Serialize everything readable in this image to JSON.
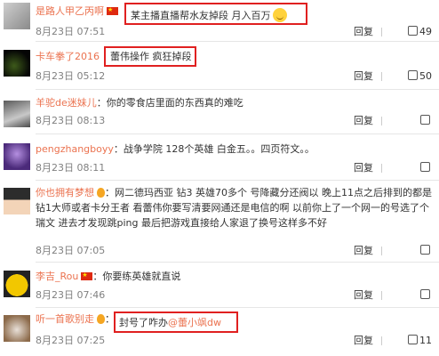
{
  "comments": [
    {
      "username": "是路人甲乙丙啊",
      "has_flag": true,
      "text": "某主播直播帮水友掉段 月入百万",
      "has_emoji": true,
      "date": "8月23日 07:51",
      "reply": "回复",
      "likes": "49",
      "highlighted": true,
      "avatar_colors": [
        "#cfcfcf",
        "#8a8a8a"
      ]
    },
    {
      "username": "卡车拳了2016",
      "has_flag": false,
      "text": "蕾伟操作 疯狂掉段",
      "date": "8月23日 05:12",
      "reply": "回复",
      "likes": "50",
      "highlighted": true,
      "avatar_colors": [
        "#0a0a0a",
        "#2b3a1a"
      ]
    },
    {
      "username": "羊驼de迷妹儿",
      "separator": "：",
      "text": "你的零食店里面的东西真的难吃",
      "date": "8月23日 08:13",
      "reply": "回复",
      "likes": "",
      "avatar_colors": [
        "#6e6e6e",
        "#c0c0c0"
      ]
    },
    {
      "username": "pengzhangboyy",
      "separator": "：",
      "text": "战争学院 128个英雄 白金五。。四页符文。。",
      "date": "8月23日 08:11",
      "reply": "回复",
      "likes": "",
      "avatar_colors": [
        "#4b2a7a",
        "#b48fe0"
      ]
    },
    {
      "username": "你也拥有梦想",
      "has_vip": true,
      "separator": "：",
      "text": "网二德玛西亚 钻3 英雄70多个 号降藏分还阀以 晚上11点之后排到的都是钻1大师或者卡分王者 看蕾伟你要写清要网通还是电信的啊 以前你上了一个网一的号选了个瑞文 进去才发现跳ping 最后把游戏直接给人家退了换号这样多不好",
      "date": "8月23日 07:05",
      "reply": "回复",
      "likes": "",
      "avatar_colors": [
        "#2c2c2c",
        "#f3d4b8"
      ]
    },
    {
      "username": "李吉_Rou",
      "has_flag": true,
      "separator": "：",
      "text": "你要练英雄就直说",
      "date": "8月23日 07:46",
      "reply": "回复",
      "likes": "",
      "avatar_colors": [
        "#f2c700",
        "#222222"
      ]
    },
    {
      "username": "听一首歌别走",
      "has_vip": true,
      "separator": "：",
      "text": "封号了咋办",
      "mention": "@蕾小飒dw",
      "date": "8月23日 07:25",
      "reply": "回复",
      "likes": "11",
      "highlighted": true,
      "avatar_colors": [
        "#d9d9d9",
        "#8c6a4a"
      ]
    }
  ]
}
